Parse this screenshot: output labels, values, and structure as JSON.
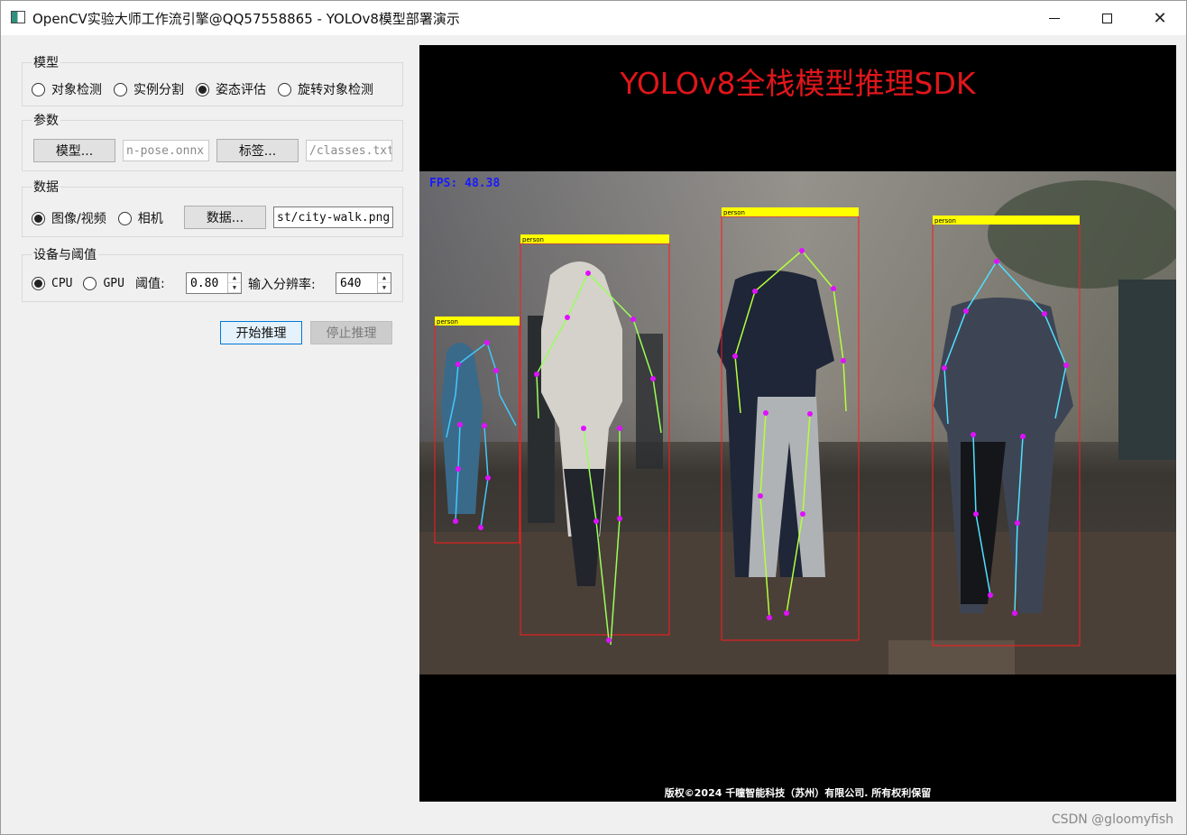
{
  "window": {
    "title": "OpenCV实验大师工作流引擎@QQ57558865 - YOLOv8模型部署演示"
  },
  "model_group": {
    "title": "模型",
    "options": [
      "对象检测",
      "实例分割",
      "姿态评估",
      "旋转对象检测"
    ],
    "selected": "姿态评估"
  },
  "params_group": {
    "title": "参数",
    "model_button": "模型...",
    "model_path": "n-pose.onnx",
    "label_button": "标签...",
    "label_path": "/classes.txt"
  },
  "data_group": {
    "title": "数据",
    "options": [
      "图像/视频",
      "相机"
    ],
    "selected": "图像/视频",
    "data_button": "数据...",
    "data_path": "st/city-walk.png"
  },
  "device_group": {
    "title": "设备与阈值",
    "options": [
      "CPU",
      "GPU"
    ],
    "selected": "CPU",
    "threshold_label": "阈值:",
    "threshold_value": "0.80",
    "resolution_label": "输入分辨率:",
    "resolution_value": "640"
  },
  "actions": {
    "start": "开始推理",
    "stop": "停止推理"
  },
  "display": {
    "banner": "YOLOv8全栈模型推理SDK",
    "fps_text": "FPS: 48.38",
    "detection_label": "person",
    "footer": "版权©2024 千瞳智能科技（苏州）有限公司. 所有权利保留"
  },
  "watermark": "CSDN @gloomyfish"
}
